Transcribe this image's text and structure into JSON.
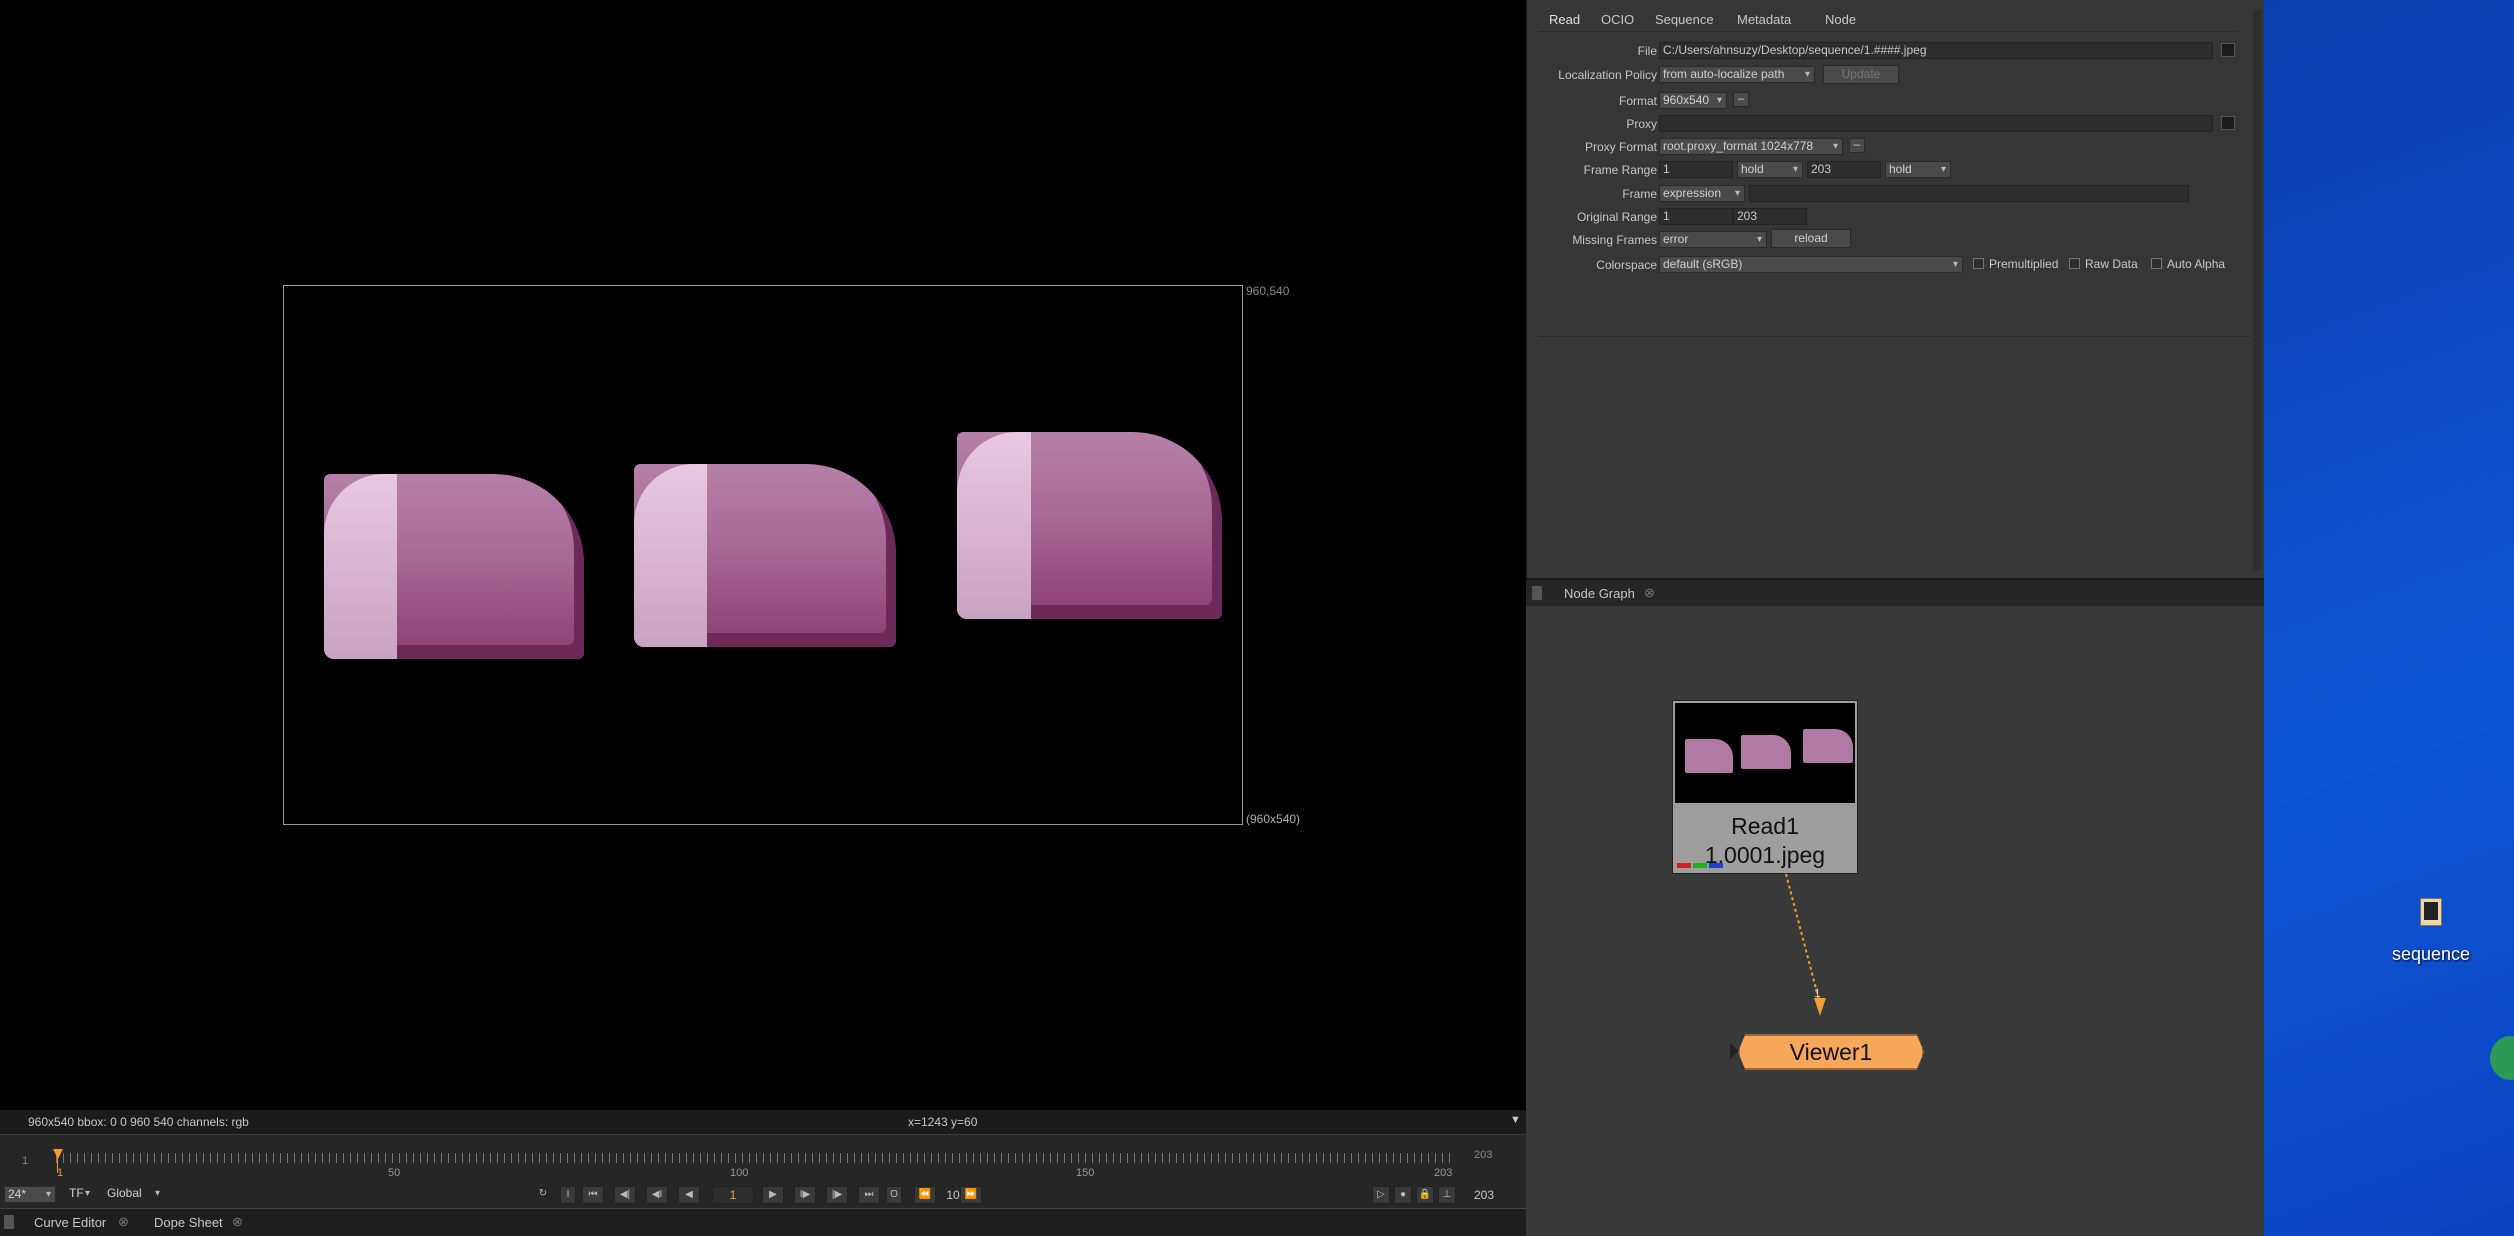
{
  "viewer": {
    "corner_top_right": "960,540",
    "corner_bottom_right": "(960x540)",
    "info_left": "960x540  bbox: 0 0 960 540 channels: rgb",
    "info_center": "x=1243 y=60"
  },
  "timeline": {
    "start": "1",
    "end_label": "203",
    "ticks": [
      "1",
      "50",
      "100",
      "150",
      "203"
    ],
    "current_frame": "1"
  },
  "controls": {
    "fps": "24*",
    "tf": "TF",
    "global": "Global",
    "frame_field": "1",
    "step": "10",
    "end_frame": "203"
  },
  "bottom_tabs": [
    {
      "label": "Curve Editor"
    },
    {
      "label": "Dope Sheet"
    }
  ],
  "properties": {
    "tabs": [
      "Read",
      "OCIO",
      "Sequence",
      "Metadata",
      "Node"
    ],
    "file_label": "File",
    "file_value": "C:/Users/ahnsuzy/Desktop/sequence/1.####.jpeg",
    "localization_label": "Localization Policy",
    "localization_value": "from auto-localize path",
    "update_label": "Update",
    "format_label": "Format",
    "format_value": "960x540",
    "proxy_label": "Proxy",
    "proxy_value": "",
    "proxy_format_label": "Proxy Format",
    "proxy_format_value": "root.proxy_format 1024x778",
    "frame_range_label": "Frame Range",
    "frame_range_start": "1",
    "frame_range_before": "hold",
    "frame_range_end": "203",
    "frame_range_after": "hold",
    "frame_label": "Frame",
    "frame_mode": "expression",
    "original_range_label": "Original Range",
    "original_range_start": "1",
    "original_range_end": "203",
    "missing_frames_label": "Missing Frames",
    "missing_frames_value": "error",
    "reload_label": "reload",
    "colorspace_label": "Colorspace",
    "colorspace_value": "default (sRGB)",
    "premultiplied_label": "Premultiplied",
    "raw_data_label": "Raw Data",
    "auto_alpha_label": "Auto Alpha"
  },
  "node_graph": {
    "tab_label": "Node Graph",
    "read_node_name": "Read1",
    "read_node_file": "1.0001.jpeg",
    "input_number": "1",
    "viewer_node_name": "Viewer1"
  },
  "desktop": {
    "icon_label": "sequence"
  },
  "colors": {
    "viewer_node": "#f7a75a",
    "desktop_bg": "#0d55d6",
    "playhead": "#f0a030"
  }
}
